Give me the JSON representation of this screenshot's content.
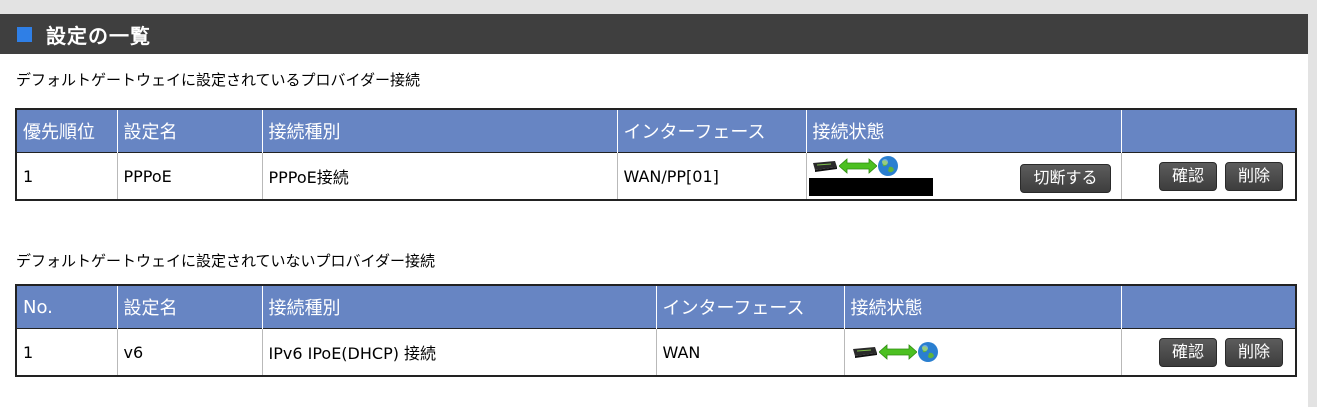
{
  "panel": {
    "title": "設定の一覧"
  },
  "default_section": {
    "label": "デフォルトゲートウェイに設定されているプロバイダー接続",
    "columns": [
      "優先順位",
      "設定名",
      "接続種別",
      "インターフェース",
      "接続状態",
      ""
    ],
    "row": {
      "priority": "1",
      "name": "PPPoE",
      "type": "PPPoE接続",
      "interface": "WAN/PP[01]",
      "disconnect_label": "切断する",
      "confirm_label": "確認",
      "delete_label": "削除"
    }
  },
  "other_section": {
    "label": "デフォルトゲートウェイに設定されていないプロバイダー接続",
    "columns": [
      "No.",
      "設定名",
      "接続種別",
      "インターフェース",
      "接続状態",
      ""
    ],
    "row": {
      "no": "1",
      "name": "v6",
      "type": "IPv6 IPoE(DHCP) 接続",
      "interface": "WAN",
      "confirm_label": "確認",
      "delete_label": "削除"
    }
  },
  "icons": {
    "router": "router-icon",
    "link": "connection-arrows-icon",
    "globe": "globe-icon"
  },
  "colors": {
    "header_bg": "#3f3f3f",
    "accent_square": "#2f7fe6",
    "table_header_bg": "#6785c3",
    "button_bg": "#4a4a4a",
    "link_arrow": "#4cc021"
  }
}
